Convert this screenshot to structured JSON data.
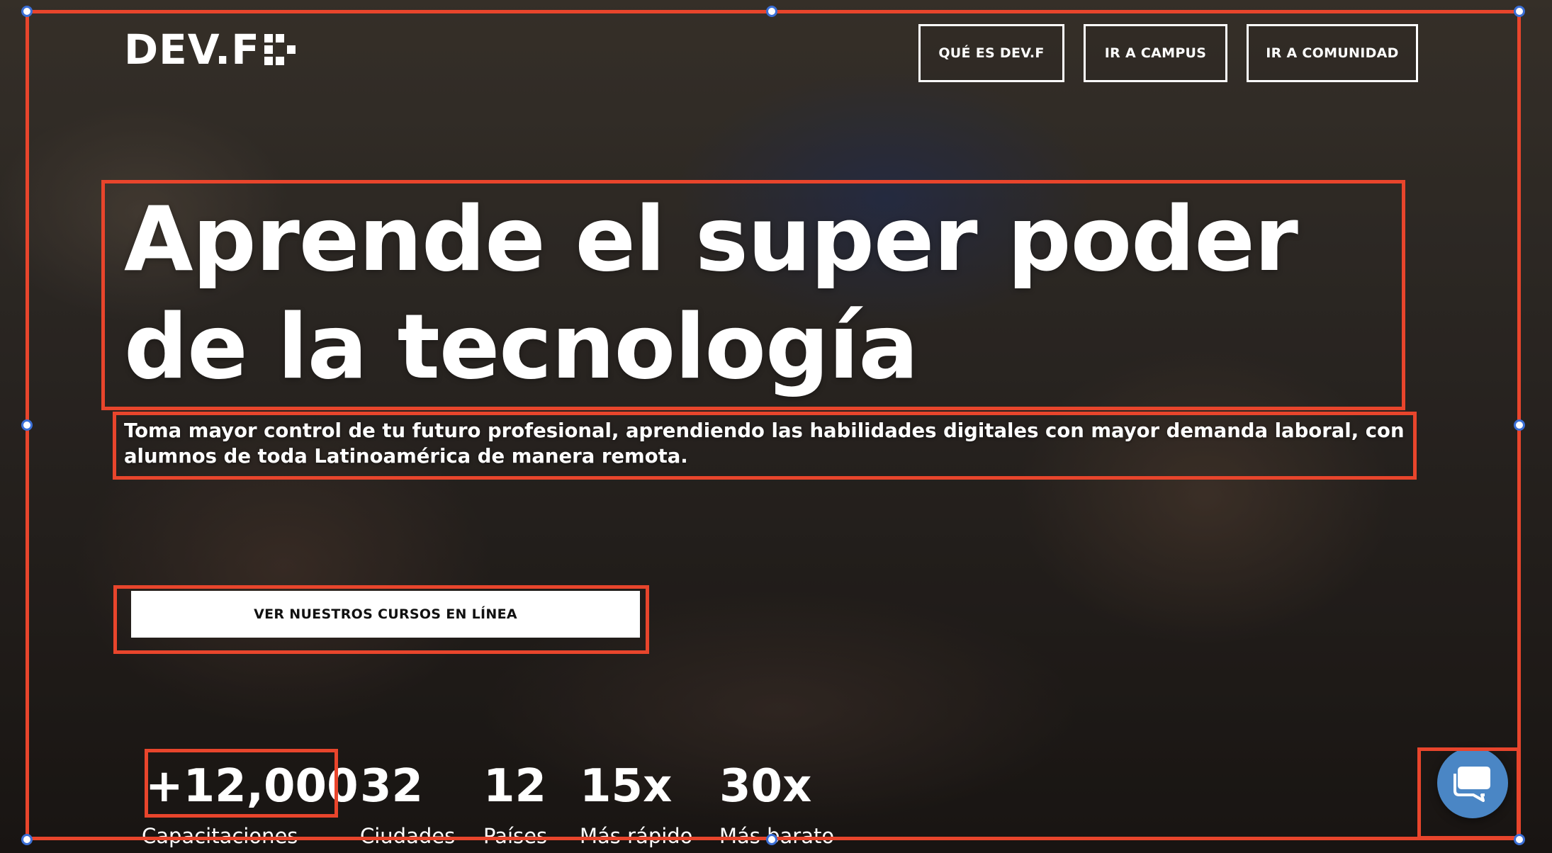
{
  "logo": {
    "text": "DEV.F"
  },
  "nav": {
    "items": [
      {
        "label": "QUÉ ES DEV.F"
      },
      {
        "label": "IR A CAMPUS"
      },
      {
        "label": "IR A COMUNIDAD"
      }
    ]
  },
  "hero": {
    "headline": "Aprende el super poder de la tecnología",
    "subline": "Toma mayor control de tu futuro profesional, aprendiendo las habilidades digitales con mayor demanda laboral, con alumnos de toda Latinoamérica de manera remota.",
    "cta_label": "VER NUESTROS CURSOS EN LÍNEA"
  },
  "stats": [
    {
      "value": "+12,000",
      "label": "Capacitaciones"
    },
    {
      "value": "32",
      "label": "Ciudades"
    },
    {
      "value": "12",
      "label": "Países"
    },
    {
      "value": "15x",
      "label": "Más rápido"
    },
    {
      "value": "30x",
      "label": "Más barato"
    }
  ],
  "chat": {
    "icon": "chat-bubble-icon",
    "color": "#4a86c5"
  },
  "editor": {
    "selection_color": "#e8452c",
    "handle_color": "#3b6fd6"
  }
}
